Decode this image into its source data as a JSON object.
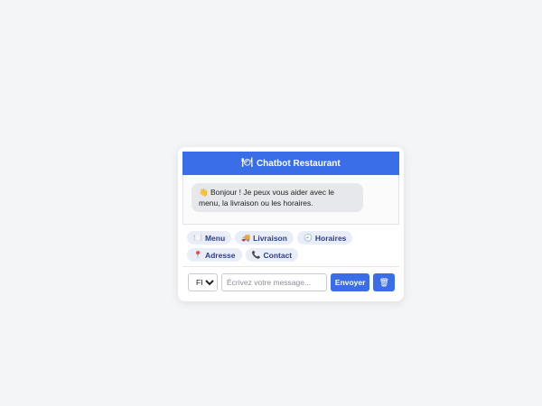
{
  "header": {
    "icon": "🍽",
    "title": "Chatbot Restaurant"
  },
  "messages": [
    {
      "from": "bot",
      "icon": "👋",
      "text": "Bonjour ! Je peux vous aider avec le menu, la livraison ou les horaires."
    }
  ],
  "quick_actions": [
    {
      "icon": "🍽️",
      "label": "Menu"
    },
    {
      "icon": "🚚",
      "label": "Livraison"
    },
    {
      "icon": "🕘",
      "label": "Horaires"
    },
    {
      "icon": "📍",
      "label": "Adresse"
    },
    {
      "icon": "📞",
      "label": "Contact"
    }
  ],
  "input": {
    "language_selected": "FR",
    "language_options": [
      "FR"
    ],
    "placeholder": "Écrivez votre message...",
    "value": "",
    "send_label": "Envoyer",
    "clear_icon": "🗑"
  },
  "colors": {
    "accent": "#3a6ee8",
    "page_bg": "#f4f5f7",
    "chip_bg": "#e9edf8",
    "bubble_bg": "#e7e8ec"
  }
}
